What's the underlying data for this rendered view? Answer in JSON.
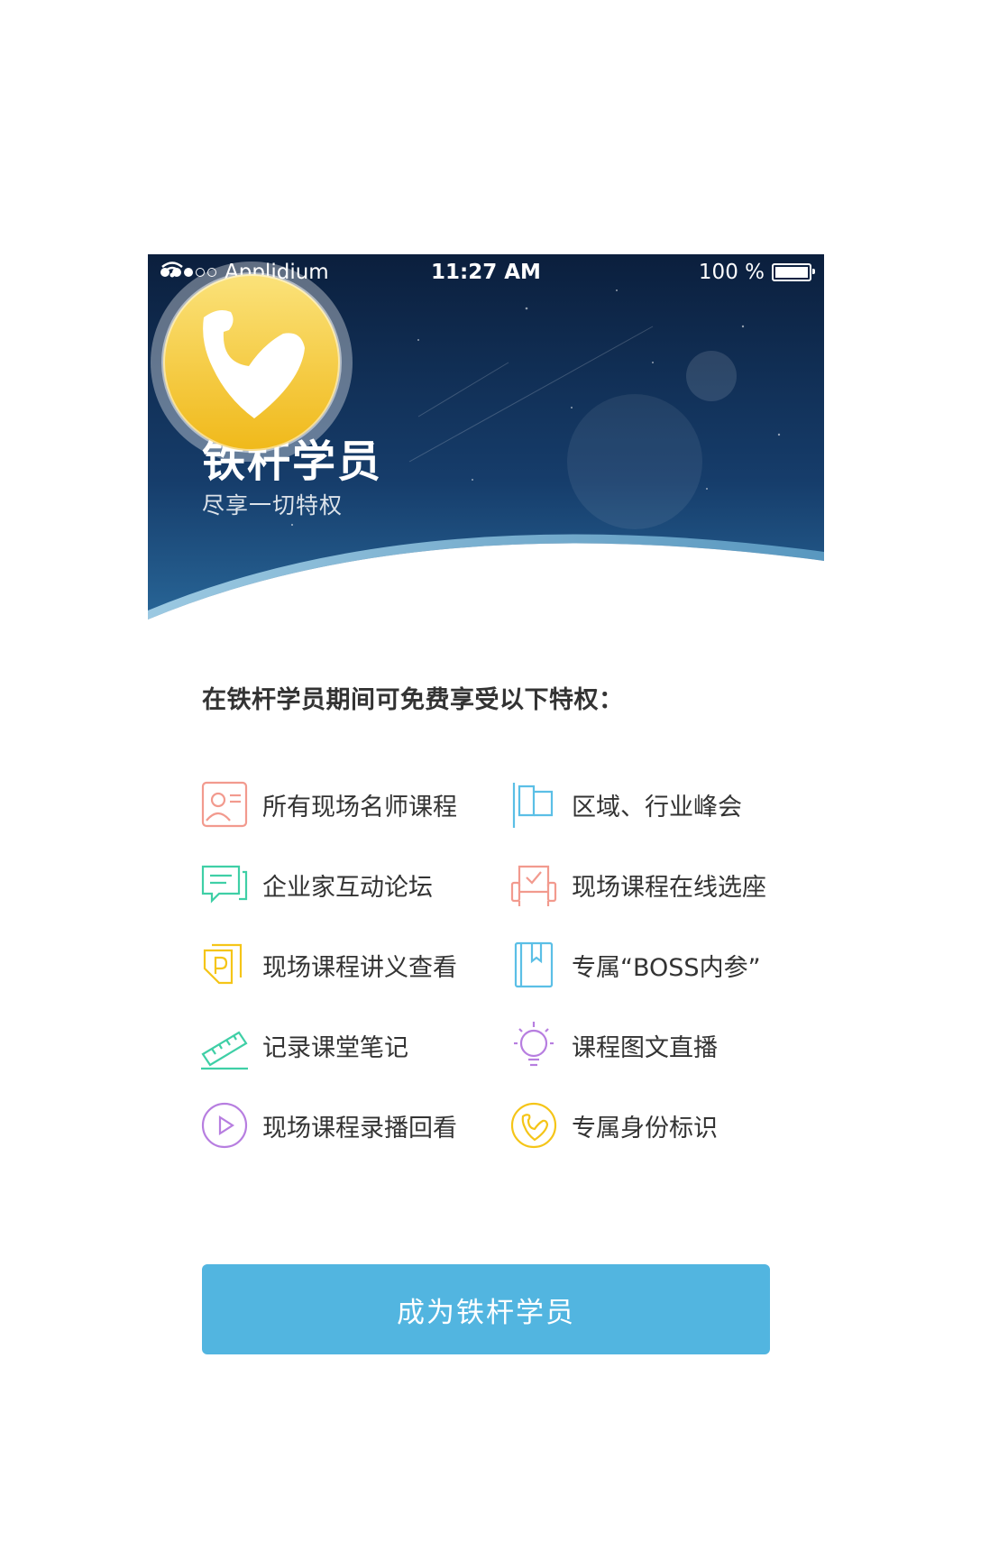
{
  "status_bar": {
    "carrier": "Applidium",
    "time": "11:27 AM",
    "battery": "100 %"
  },
  "header": {
    "title": "铁杆学员",
    "subtitle": "尽享一切特权"
  },
  "intro": "在铁杆学员期间可免费享受以下特权：",
  "perks": [
    {
      "label": "所有现场名师课程",
      "icon": "teacher-icon",
      "color": "#f29a8e"
    },
    {
      "label": "区域、行业峰会",
      "icon": "flag-icon",
      "color": "#5bbfe6"
    },
    {
      "label": "企业家互动论坛",
      "icon": "chat-icon",
      "color": "#3fcfa6"
    },
    {
      "label": "现场课程在线选座",
      "icon": "seat-icon",
      "color": "#f29a8e"
    },
    {
      "label": "现场课程讲义查看",
      "icon": "handout-icon",
      "color": "#f5c518"
    },
    {
      "label": "专属“BOSS内参”",
      "icon": "book-icon",
      "color": "#5bbfe6"
    },
    {
      "label": "记录课堂笔记",
      "icon": "ruler-icon",
      "color": "#3fcfa6"
    },
    {
      "label": "课程图文直播",
      "icon": "lightbulb-icon",
      "color": "#b77ee0"
    },
    {
      "label": "现场课程录播回看",
      "icon": "play-icon",
      "color": "#b77ee0"
    },
    {
      "label": "专属身份标识",
      "icon": "badge-icon",
      "color": "#f5c518"
    }
  ],
  "cta": {
    "label": "成为铁杆学员"
  },
  "colors": {
    "accent": "#52b5e0",
    "hero_dark": "#0d2445",
    "badge": "#f5c518"
  }
}
